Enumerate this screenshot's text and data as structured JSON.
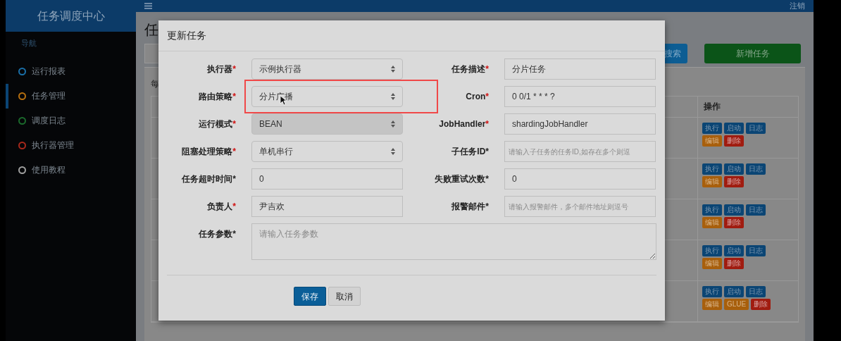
{
  "header": {
    "brand": "任务调度中心",
    "logout": "注销"
  },
  "sidebar": {
    "heading": "导航",
    "items": [
      {
        "label": "运行报表",
        "color": "#1a6fa8",
        "selected": false
      },
      {
        "label": "任务管理",
        "color": "#b8700f",
        "selected": true
      },
      {
        "label": "调度日志",
        "color": "#1b6a2c",
        "selected": false
      },
      {
        "label": "执行器管理",
        "color": "#a8281b",
        "selected": false
      },
      {
        "label": "使用教程",
        "color": "#a0a0a0",
        "selected": false
      }
    ]
  },
  "page": {
    "title": "任",
    "search_button": "搜索",
    "add_button": "新增任务",
    "length_text": "每",
    "table": {
      "action_column": "操作",
      "rows": [
        {
          "actions": [
            {
              "label": "执行",
              "kind": "primary"
            },
            {
              "label": "启动",
              "kind": "primary"
            },
            {
              "label": "日志",
              "kind": "primary"
            },
            {
              "label": "编辑",
              "kind": "warning"
            },
            {
              "label": "删除",
              "kind": "danger"
            }
          ]
        },
        {
          "actions": [
            {
              "label": "执行",
              "kind": "primary"
            },
            {
              "label": "启动",
              "kind": "primary"
            },
            {
              "label": "日志",
              "kind": "primary"
            },
            {
              "label": "编辑",
              "kind": "warning"
            },
            {
              "label": "删除",
              "kind": "danger"
            }
          ]
        },
        {
          "actions": [
            {
              "label": "执行",
              "kind": "primary"
            },
            {
              "label": "启动",
              "kind": "primary"
            },
            {
              "label": "日志",
              "kind": "primary"
            },
            {
              "label": "编辑",
              "kind": "warning"
            },
            {
              "label": "删除",
              "kind": "danger"
            }
          ]
        },
        {
          "actions": [
            {
              "label": "执行",
              "kind": "primary"
            },
            {
              "label": "启动",
              "kind": "primary"
            },
            {
              "label": "日志",
              "kind": "primary"
            },
            {
              "label": "编辑",
              "kind": "warning"
            },
            {
              "label": "删除",
              "kind": "danger"
            }
          ]
        },
        {
          "actions": [
            {
              "label": "执行",
              "kind": "primary"
            },
            {
              "label": "启动",
              "kind": "primary"
            },
            {
              "label": "日志",
              "kind": "primary"
            },
            {
              "label": "编辑",
              "kind": "warning"
            },
            {
              "label": "GLUE",
              "kind": "warning"
            },
            {
              "label": "删除",
              "kind": "danger"
            }
          ]
        }
      ]
    }
  },
  "dialog": {
    "title": "更新任务",
    "fields": [
      {
        "label": "执行器",
        "mark": "*",
        "mark_red": true,
        "kind": "select",
        "value": "示例执行器",
        "disabled": false,
        "highlighted": false
      },
      {
        "label": "任务描述",
        "mark": "*",
        "mark_red": true,
        "kind": "input",
        "value": "分片任务"
      },
      {
        "label": "路由策略",
        "mark": "*",
        "mark_red": true,
        "kind": "select",
        "value": "分片广播",
        "disabled": false,
        "highlighted": true
      },
      {
        "label": "Cron",
        "mark": "*",
        "mark_red": true,
        "kind": "input",
        "value": "0 0/1 * * * ?"
      },
      {
        "label": "运行模式",
        "mark": "*",
        "mark_red": true,
        "kind": "select",
        "value": "BEAN",
        "disabled": true,
        "highlighted": false
      },
      {
        "label": "JobHandler",
        "mark": "*",
        "mark_red": true,
        "kind": "input",
        "value": "shardingJobHandler"
      },
      {
        "label": "阻塞处理策略",
        "mark": "*",
        "mark_red": true,
        "kind": "select",
        "value": "单机串行",
        "disabled": false,
        "highlighted": false
      },
      {
        "label": "子任务ID",
        "mark": "*",
        "mark_red": false,
        "kind": "input",
        "placeholder": "请输入子任务的任务ID,如存在多个则逗"
      },
      {
        "label": "任务超时时间",
        "mark": "*",
        "mark_red": false,
        "kind": "input",
        "value": "0"
      },
      {
        "label": "失败重试次数",
        "mark": "*",
        "mark_red": false,
        "kind": "input",
        "value": "0"
      },
      {
        "label": "负责人",
        "mark": "*",
        "mark_red": true,
        "kind": "input",
        "value": "尹吉欢"
      },
      {
        "label": "报警邮件",
        "mark": "*",
        "mark_red": false,
        "kind": "input",
        "placeholder": "请输入报警邮件，多个邮件地址则逗号"
      },
      {
        "label": "任务参数",
        "mark": "*",
        "mark_red": false,
        "kind": "textarea",
        "placeholder": "请输入任务参数"
      }
    ],
    "buttons": [
      {
        "label": "保存",
        "kind": "primary"
      },
      {
        "label": "取消",
        "kind": "default"
      }
    ]
  }
}
